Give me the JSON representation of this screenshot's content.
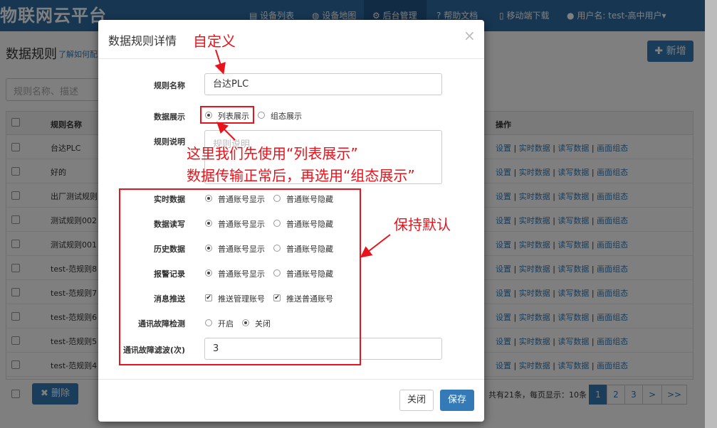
{
  "navbar": {
    "brand": "物联网云平台",
    "items": [
      {
        "icon": "list-icon",
        "label": "设备列表"
      },
      {
        "icon": "globe-icon",
        "label": "设备地图"
      },
      {
        "icon": "gears-icon",
        "label": "后台管理"
      },
      {
        "icon": "question-icon",
        "label": "帮助文档"
      },
      {
        "icon": "mobile-icon",
        "label": "移动端下载"
      },
      {
        "icon": "user-icon",
        "label": "用户名: test-高中用户▾"
      }
    ]
  },
  "page": {
    "title": "数据规则",
    "help_link": "了解如何配",
    "new_button": "新增",
    "search_placeholder": "规则名称、描述",
    "columns": {
      "name": "规则名称",
      "ops": "操作"
    },
    "rows": [
      "台达PLC",
      "好的",
      "出厂测试规则",
      "测试规则002",
      "测试规则001",
      "test-范规则8",
      "test-范规则7",
      "test-范规则6",
      "test-范规则5",
      "test-范规则4"
    ],
    "ops": [
      "设置",
      "实时数据",
      "读写数据",
      "画面组态"
    ],
    "delete_button": "删除",
    "pagination_info": "共有21条，每页显示：10条",
    "pages": [
      "1",
      "2",
      "3",
      ">",
      ">>"
    ]
  },
  "modal": {
    "title": "数据规则详情",
    "close": "×",
    "name_label": "规则名称",
    "name_value": "台达PLC",
    "display_label": "数据展示",
    "display_options": [
      "列表展示",
      "组态展示"
    ],
    "desc_label": "规则说明",
    "desc_placeholder": "规则说明",
    "settings": [
      {
        "label": "实时数据",
        "type": "radio",
        "options": [
          "普通账号显示",
          "普通账号隐藏"
        ],
        "checked": [
          true,
          false
        ]
      },
      {
        "label": "数据读写",
        "type": "radio",
        "options": [
          "普通账号显示",
          "普通账号隐藏"
        ],
        "checked": [
          true,
          false
        ]
      },
      {
        "label": "历史数据",
        "type": "radio",
        "options": [
          "普通账号显示",
          "普通账号隐藏"
        ],
        "checked": [
          true,
          false
        ]
      },
      {
        "label": "报警记录",
        "type": "radio",
        "options": [
          "普通账号显示",
          "普通账号隐藏"
        ],
        "checked": [
          true,
          false
        ]
      },
      {
        "label": "消息推送",
        "type": "checkbox",
        "options": [
          "推送管理账号",
          "推送普通账号"
        ],
        "checked": [
          true,
          true
        ]
      },
      {
        "label": "通讯故障检测",
        "type": "radio",
        "options": [
          "开启",
          "关闭"
        ],
        "checked": [
          false,
          true
        ]
      }
    ],
    "filter_label": "通讯故障滤波(次)",
    "filter_value": "3",
    "close_button": "关闭",
    "save_button": "保存"
  },
  "annotations": {
    "custom": "自定义",
    "note_line1": "这里我们先使用“列表展示”",
    "note_line2": "数据传输正常后，再选用“组态展示”",
    "keep_default": "保持默认"
  },
  "colors": {
    "primary": "#337ab7",
    "navbar": "#2e6da4",
    "annotation": "#e8131b"
  }
}
